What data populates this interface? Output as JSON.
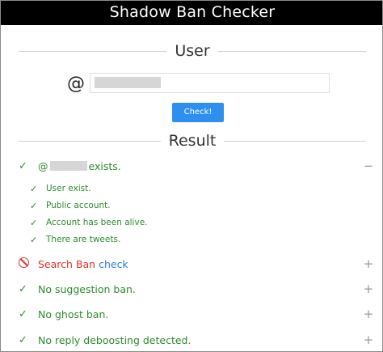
{
  "app": {
    "title": "Shadow Ban Checker"
  },
  "user_section": {
    "heading": "User",
    "at_symbol": "@",
    "input_value": "",
    "button_label": "Check!"
  },
  "result_section": {
    "heading": "Result",
    "summary": {
      "prefix": "@",
      "suffix": "exists.",
      "toggle": "−",
      "details": [
        "User exist.",
        "Public account.",
        "Account has been alive.",
        "There are tweets."
      ]
    },
    "checks": [
      {
        "label": "Search Ban",
        "link": "check",
        "status": "ban",
        "toggle": "+"
      },
      {
        "label": "No suggestion ban.",
        "status": "ok",
        "toggle": "+"
      },
      {
        "label": "No ghost ban.",
        "status": "ok",
        "toggle": "+"
      },
      {
        "label": "No reply deboosting detected.",
        "status": "ok",
        "toggle": "+"
      }
    ]
  },
  "icons": {
    "ok": "check-icon",
    "ban": "ban-icon"
  },
  "colors": {
    "ok": "#2e8b2e",
    "ban": "#e03030",
    "link": "#2a7ae2",
    "button": "#2e8ff0"
  }
}
